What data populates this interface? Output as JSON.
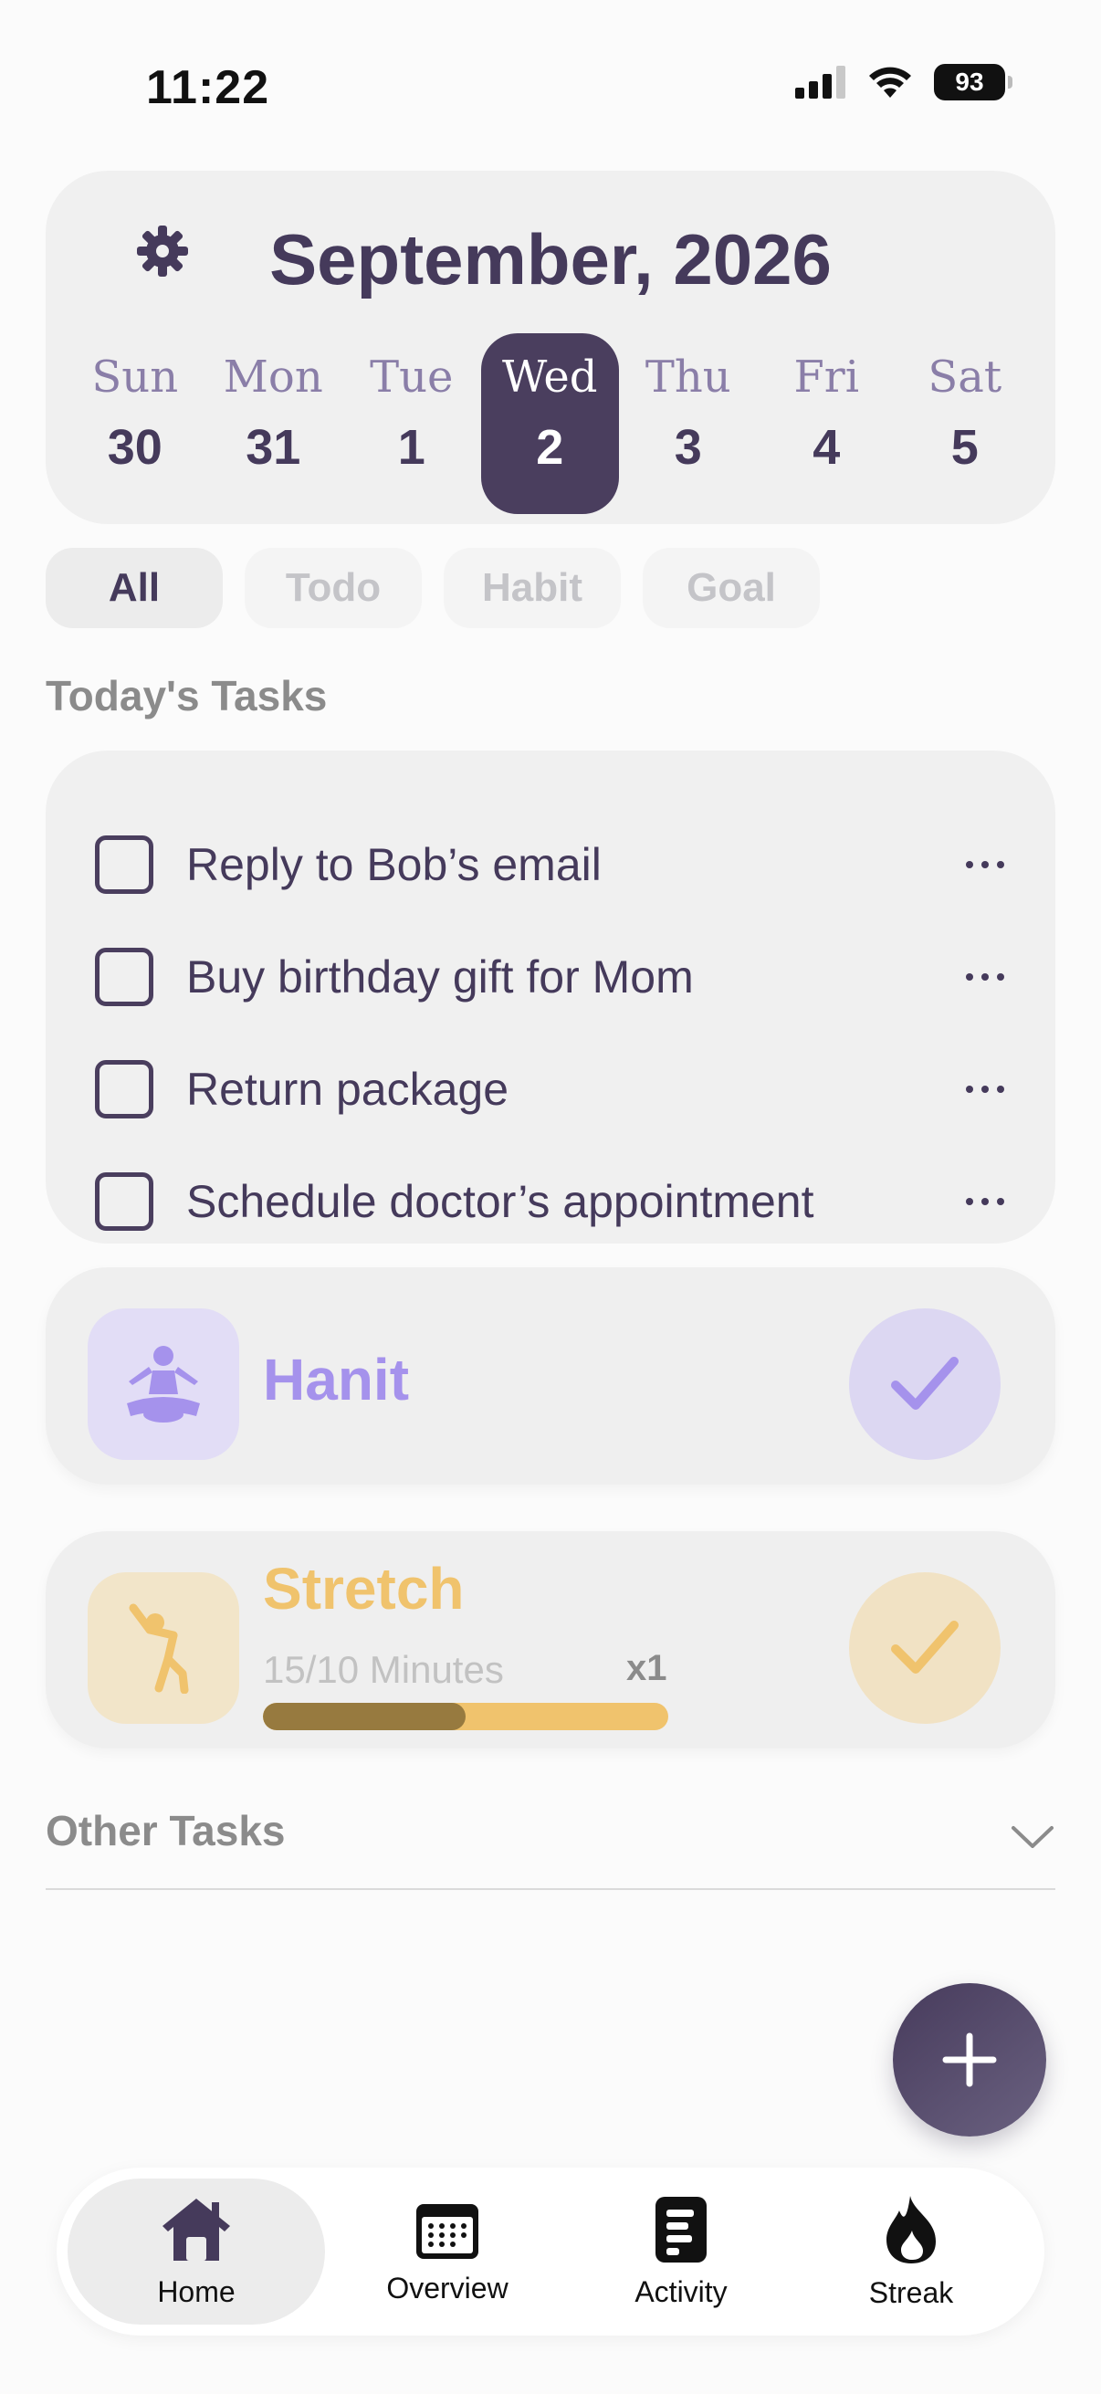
{
  "status_bar": {
    "time": "11:22",
    "battery": "93"
  },
  "calendar": {
    "title": "September, 2026",
    "days": [
      {
        "name": "Sun",
        "num": "30"
      },
      {
        "name": "Mon",
        "num": "31"
      },
      {
        "name": "Tue",
        "num": "1"
      },
      {
        "name": "Wed",
        "num": "2"
      },
      {
        "name": "Thu",
        "num": "3"
      },
      {
        "name": "Fri",
        "num": "4"
      },
      {
        "name": "Sat",
        "num": "5"
      }
    ],
    "selected_day": "Wed"
  },
  "filters": [
    "All",
    "Todo",
    "Habit",
    "Goal"
  ],
  "active_filter": "All",
  "today": {
    "heading": "Today's Tasks",
    "todos": [
      {
        "label": "Reply to Bob’s email",
        "done": false
      },
      {
        "label": "Buy birthday gift for Mom",
        "done": false
      },
      {
        "label": "Return package",
        "done": false
      },
      {
        "label": "Schedule doctor’s appointment",
        "done": false
      }
    ],
    "habits": [
      {
        "title": "Hanit",
        "icon": "meditation-icon",
        "color": "#a592ec",
        "icon_bg": "#e2ddf6",
        "check_bg": "#dcd7f2"
      },
      {
        "title": "Stretch",
        "icon": "stretch-icon",
        "color": "#f0c36d",
        "icon_bg": "#f2e5c9",
        "check_bg": "#f1e2c4",
        "progress_text": "15/10 Minutes",
        "multiplier": "x1",
        "progress": 0.5,
        "progress_done_color": "#977a3f",
        "progress_track_color": "#f0c36d"
      }
    ]
  },
  "other": {
    "heading": "Other Tasks"
  },
  "nav": [
    {
      "label": "Home",
      "icon": "home-icon"
    },
    {
      "label": "Overview",
      "icon": "calendar-icon"
    },
    {
      "label": "Activity",
      "icon": "activity-icon"
    },
    {
      "label": "Streak",
      "icon": "flame-icon"
    }
  ],
  "active_nav": "Home",
  "colors": {
    "primary": "#453a5b",
    "card": "#f0f0f0",
    "background": "#fbfbfb"
  }
}
